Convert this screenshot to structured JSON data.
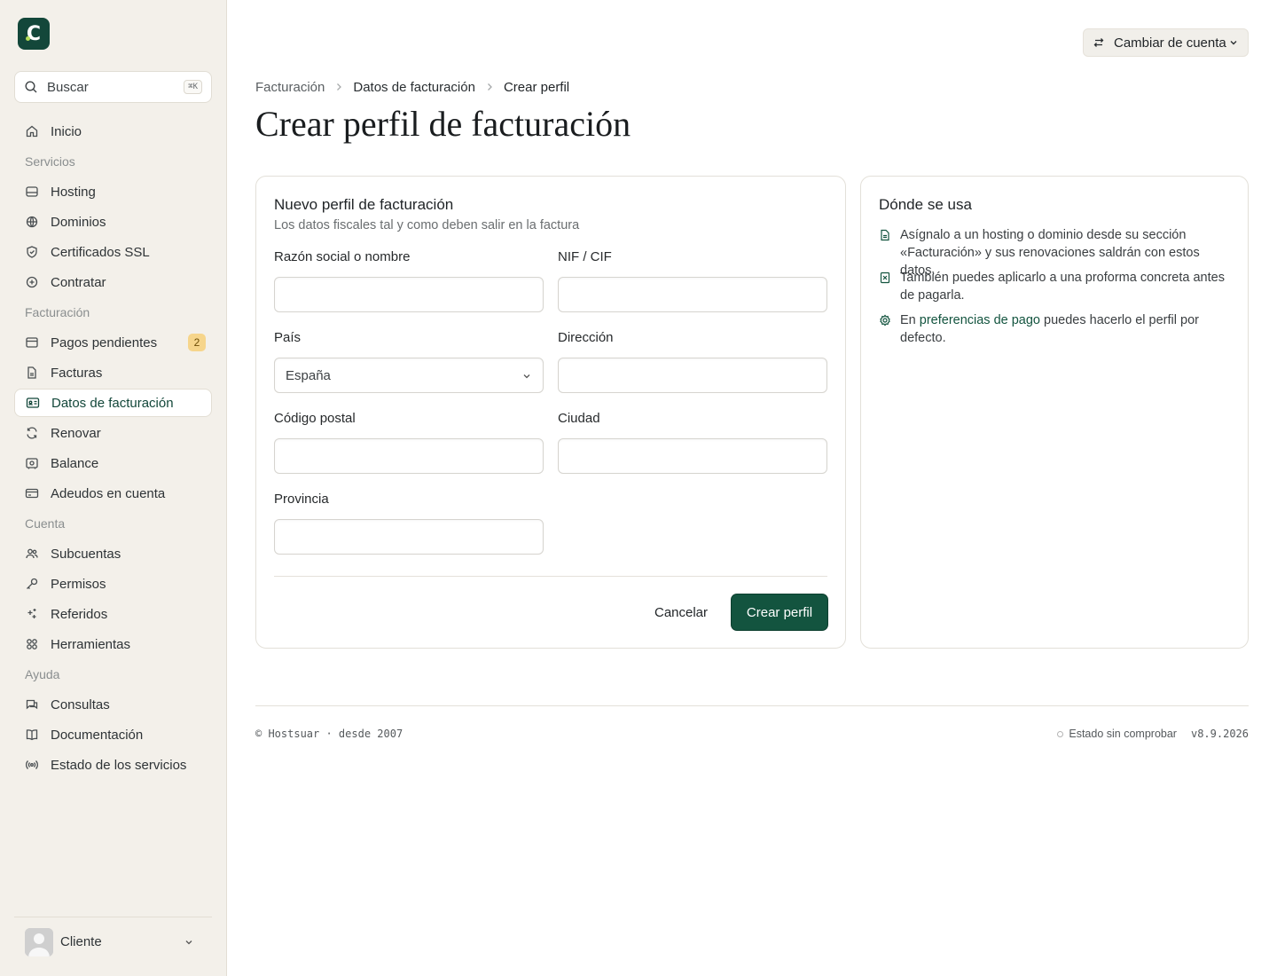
{
  "app": {
    "logo_letter": "C",
    "brand_color": "#13473a",
    "accent_green": "#13543f",
    "badge_color": "#f6d58b"
  },
  "search": {
    "placeholder": "Buscar",
    "shortcut": "⌘K"
  },
  "sidebar": {
    "home": {
      "label": "Inicio",
      "icon": "home-icon"
    },
    "sections": [
      {
        "title": "Servicios",
        "items": [
          {
            "label": "Hosting",
            "icon": "server-icon"
          },
          {
            "label": "Dominios",
            "icon": "globe-icon"
          },
          {
            "label": "Certificados SSL",
            "icon": "shield-icon"
          },
          {
            "label": "Contratar",
            "icon": "plus-circle-icon"
          }
        ]
      },
      {
        "title": "Facturación",
        "items": [
          {
            "label": "Pagos pendientes",
            "icon": "inbox-icon",
            "badge": "2"
          },
          {
            "label": "Facturas",
            "icon": "file-icon"
          },
          {
            "label": "Datos de facturación",
            "icon": "id-card-icon",
            "active": true
          },
          {
            "label": "Renovar",
            "icon": "refresh-icon"
          },
          {
            "label": "Balance",
            "icon": "wallet-icon"
          },
          {
            "label": "Adeudos en cuenta",
            "icon": "credit-card-icon"
          }
        ]
      },
      {
        "title": "Cuenta",
        "items": [
          {
            "label": "Subcuentas",
            "icon": "users-icon"
          },
          {
            "label": "Permisos",
            "icon": "key-icon"
          },
          {
            "label": "Referidos",
            "icon": "sparkle-icon"
          },
          {
            "label": "Herramientas",
            "icon": "tools-icon"
          }
        ]
      },
      {
        "title": "Ayuda",
        "items": [
          {
            "label": "Consultas",
            "icon": "chat-icon"
          },
          {
            "label": "Documentación",
            "icon": "book-icon"
          },
          {
            "label": "Estado de los servicios",
            "icon": "broadcast-icon"
          }
        ]
      }
    ],
    "user": {
      "name": "Cliente"
    }
  },
  "header": {
    "switch_account": "Cambiar de cuenta"
  },
  "breadcrumb": [
    "Facturación",
    "Datos de facturación",
    "Crear perfil"
  ],
  "page_title": "Crear perfil de facturación",
  "form": {
    "title": "Nuevo perfil de facturación",
    "subtitle": "Los datos fiscales tal y como deben salir en la factura",
    "fields": {
      "razon": {
        "label": "Razón social o nombre",
        "value": ""
      },
      "nif": {
        "label": "NIF / CIF",
        "value": ""
      },
      "pais": {
        "label": "País",
        "value": "España"
      },
      "direccion": {
        "label": "Dirección",
        "value": ""
      },
      "cp": {
        "label": "Código postal",
        "value": ""
      },
      "ciudad": {
        "label": "Ciudad",
        "value": ""
      },
      "provincia": {
        "label": "Provincia",
        "value": ""
      }
    },
    "cancel": "Cancelar",
    "submit": "Crear perfil"
  },
  "usage": {
    "title": "Dónde se usa",
    "items": [
      {
        "text": "Asígnalo a un hosting o dominio desde su sección «Facturación» y sus renovaciones saldrán con estos datos.",
        "icon": "document-icon"
      },
      {
        "text": "También puedes aplicarlo a una proforma concreta antes de pagarla.",
        "icon": "receipt-icon"
      },
      {
        "prefix": "En ",
        "link": "preferencias de pago",
        "suffix": " puedes hacerlo el perfil por defecto.",
        "icon": "settings-icon"
      }
    ]
  },
  "footer": {
    "copyright": "© Hostsuar · desde 2007",
    "status": "Estado sin comprobar",
    "version": "v8.9.2026"
  }
}
